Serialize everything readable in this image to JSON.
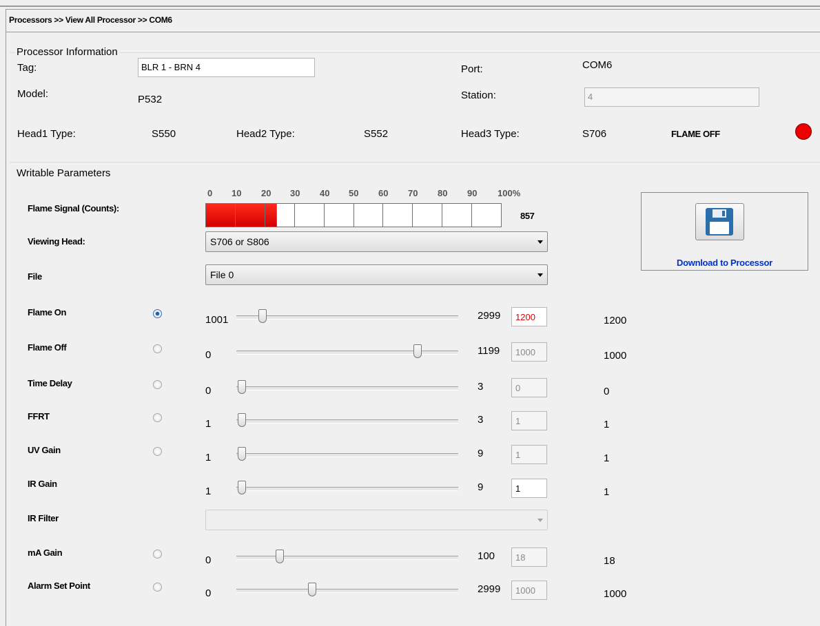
{
  "breadcrumb": "Processors >> View All Processor >> COM6",
  "processor_info": {
    "group_title": "Processor Information",
    "tag_label": "Tag:",
    "tag_value": "BLR 1 - BRN 4",
    "model_label": "Model:",
    "model_value": "P532",
    "port_label": "Port:",
    "port_value": "COM6",
    "station_label": "Station:",
    "station_value": "4",
    "head1_label": "Head1 Type:",
    "head1_value": "S550",
    "head2_label": "Head2 Type:",
    "head2_value": "S552",
    "head3_label": "Head3 Type:",
    "head3_value": "S706",
    "flame_status": "FLAME OFF",
    "flame_led_color": "#ee0000"
  },
  "writable": {
    "group_title": "Writable Parameters",
    "flame_signal_label": "Flame Signal (Counts):",
    "flame_signal_ticks": [
      "0",
      "10",
      "20",
      "30",
      "40",
      "50",
      "60",
      "70",
      "80",
      "90",
      "100%"
    ],
    "flame_signal_value": "857",
    "flame_signal_fraction": 0.24,
    "viewing_head_label": "Viewing Head:",
    "viewing_head_value": "S706 or S806",
    "file_label": "File",
    "file_value": "File 0",
    "ir_filter_label": "IR Filter",
    "ir_filter_value": "",
    "params": [
      {
        "label": "Flame On",
        "radio": true,
        "selected": true,
        "min": "1001",
        "max": "2999",
        "input": "1200",
        "current": "1200",
        "slider_value": 1200,
        "range": [
          1001,
          2999
        ],
        "input_style": "red"
      },
      {
        "label": "Flame Off",
        "radio": true,
        "selected": false,
        "min": "0",
        "max": "1199",
        "input": "1000",
        "current": "1000",
        "slider_value": 1000,
        "range": [
          0,
          1199
        ],
        "input_style": "dis"
      },
      {
        "label": "Time Delay",
        "radio": true,
        "selected": false,
        "min": "0",
        "max": "3",
        "input": "0",
        "current": "0",
        "slider_value": 0,
        "range": [
          0,
          3
        ],
        "input_style": "dis"
      },
      {
        "label": "FFRT",
        "radio": true,
        "selected": false,
        "min": "1",
        "max": "3",
        "input": "1",
        "current": "1",
        "slider_value": 1,
        "range": [
          1,
          3
        ],
        "input_style": "dis"
      },
      {
        "label": "UV Gain",
        "radio": true,
        "selected": false,
        "min": "1",
        "max": "9",
        "input": "1",
        "current": "1",
        "slider_value": 1,
        "range": [
          1,
          9
        ],
        "input_style": "dis"
      },
      {
        "label": "IR Gain",
        "radio": false,
        "selected": false,
        "min": "1",
        "max": "9",
        "input": "1",
        "current": "1",
        "slider_value": 1,
        "range": [
          1,
          9
        ],
        "input_style": "en"
      },
      {
        "label": "mA Gain",
        "radio": true,
        "selected": false,
        "min": "0",
        "max": "100",
        "input": "18",
        "current": "18",
        "slider_value": 18,
        "range": [
          0,
          100
        ],
        "input_style": "dis"
      },
      {
        "label": "Alarm Set Point",
        "radio": true,
        "selected": false,
        "min": "0",
        "max": "2999",
        "input": "1000",
        "current": "1000",
        "slider_value": 1000,
        "range": [
          0,
          2999
        ],
        "input_style": "dis"
      }
    ]
  },
  "download_label": "Download to Processor"
}
